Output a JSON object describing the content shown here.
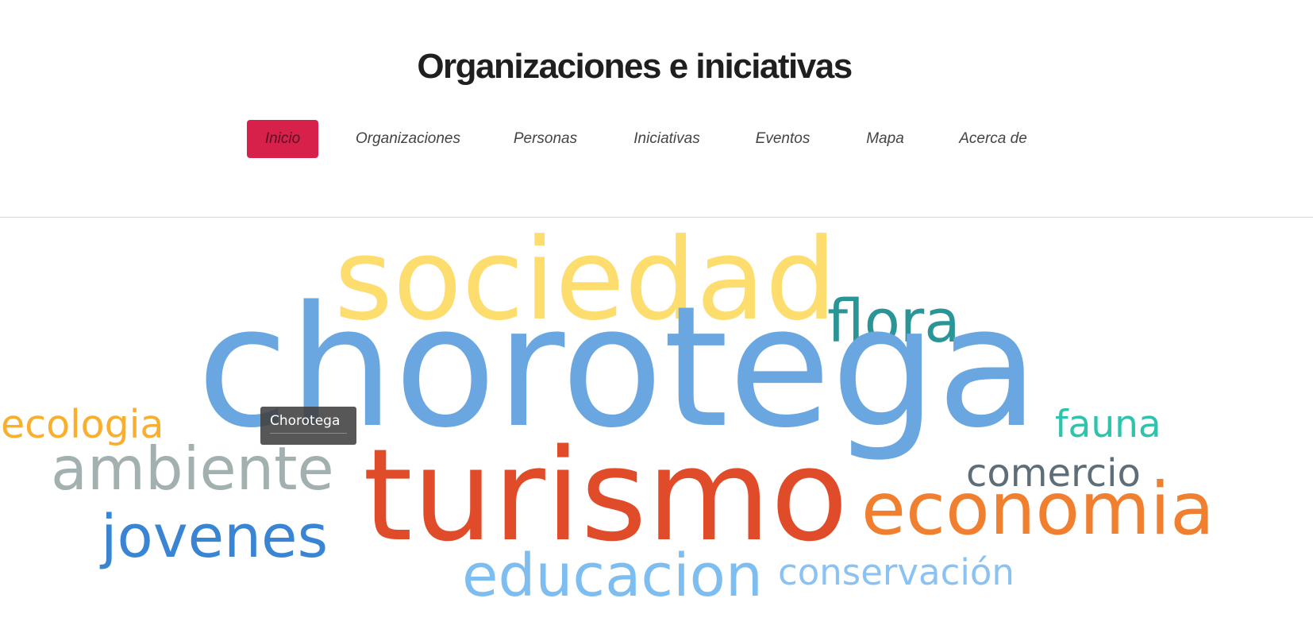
{
  "header": {
    "title": "Organizaciones e iniciativas"
  },
  "nav": {
    "items": [
      {
        "label": "Inicio",
        "active": true
      },
      {
        "label": "Organizaciones",
        "active": false
      },
      {
        "label": "Personas",
        "active": false
      },
      {
        "label": "Iniciativas",
        "active": false
      },
      {
        "label": "Eventos",
        "active": false
      },
      {
        "label": "Mapa",
        "active": false
      },
      {
        "label": "Acerca de",
        "active": false
      }
    ],
    "active_color": "#d7214b"
  },
  "word_cloud": {
    "words": [
      {
        "text": "sociedad",
        "color": "#fedd6f"
      },
      {
        "text": "flora",
        "color": "#2a9597"
      },
      {
        "text": "chorotega",
        "color": "#6aa6e0"
      },
      {
        "text": "ecologia",
        "color": "#f9ae2e"
      },
      {
        "text": "fauna",
        "color": "#2ec3ad"
      },
      {
        "text": "ambiente",
        "color": "#a2b0b0"
      },
      {
        "text": "comercio",
        "color": "#5e6e78"
      },
      {
        "text": "turismo",
        "color": "#e04c2a"
      },
      {
        "text": "economia",
        "color": "#f0802f"
      },
      {
        "text": "jovenes",
        "color": "#3a85d3"
      },
      {
        "text": "educacion",
        "color": "#7dbdf0"
      },
      {
        "text": "conservación",
        "color": "#8ac3f3"
      }
    ]
  },
  "tooltip": {
    "label": "Chorotega"
  }
}
